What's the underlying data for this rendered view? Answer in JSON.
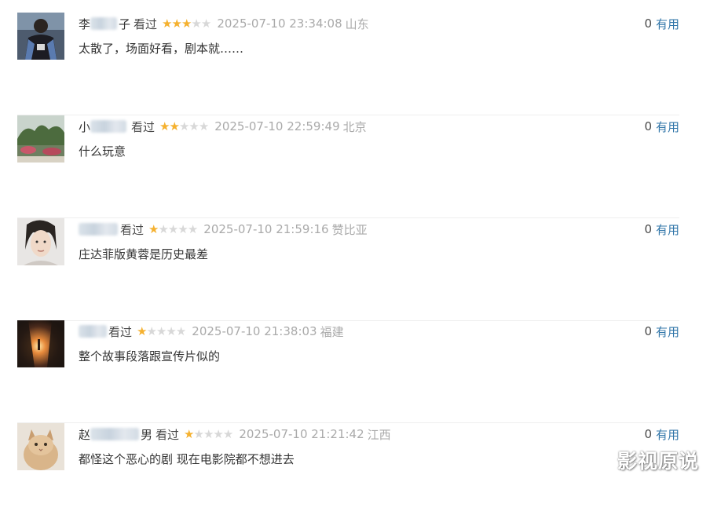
{
  "reviews": [
    {
      "name_prefix": "李",
      "name_suffix": "子",
      "status": "看过",
      "rating": 3,
      "time": "2025-07-10 23:34:08",
      "location": "山东",
      "content": "太散了，场面好看，剧本就……",
      "useful_count": "0",
      "useful_label": "有用"
    },
    {
      "name_prefix": "小",
      "name_suffix": "",
      "status": "看过",
      "rating": 2,
      "time": "2025-07-10 22:59:49",
      "location": "北京",
      "content": "什么玩意",
      "useful_count": "0",
      "useful_label": "有用"
    },
    {
      "name_prefix": "",
      "name_suffix": "",
      "status": "看过",
      "rating": 1,
      "time": "2025-07-10 21:59:16",
      "location": "赞比亚",
      "content": "庄达菲版黄蓉是历史最差",
      "useful_count": "0",
      "useful_label": "有用"
    },
    {
      "name_prefix": "",
      "name_suffix": "",
      "status": "看过",
      "rating": 1,
      "time": "2025-07-10 21:38:03",
      "location": "福建",
      "content": "整个故事段落跟宣传片似的",
      "useful_count": "0",
      "useful_label": "有用"
    },
    {
      "name_prefix": "赵",
      "name_suffix": "男",
      "status": "看过",
      "rating": 1,
      "time": "2025-07-10 21:21:42",
      "location": "江西",
      "content": "都怪这个恶心的剧 现在电影院都不想进去",
      "useful_count": "0",
      "useful_label": "有用"
    }
  ],
  "star_max": 5,
  "watermark": "影视原说",
  "colors": {
    "accent_link": "#3377aa",
    "star_on": "#f5b12f",
    "star_off": "#d8d8d8",
    "meta_gray": "#aaaaaa"
  }
}
